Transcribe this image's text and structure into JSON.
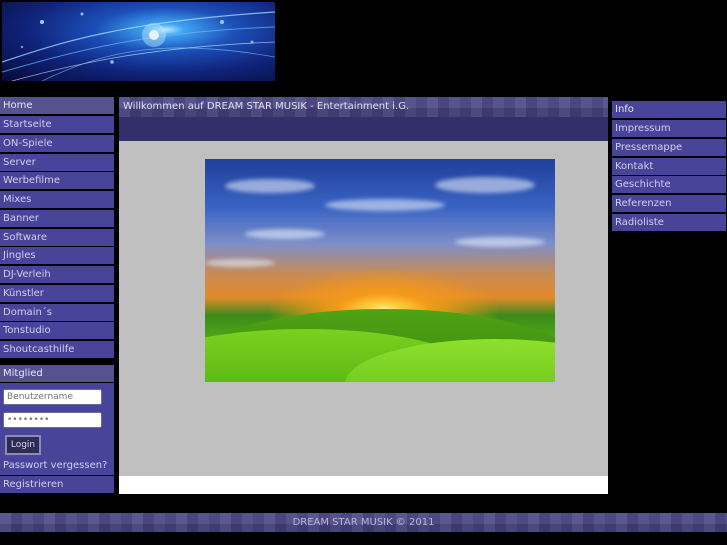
{
  "footer": {
    "copyright": "DREAM STAR MUSIK © 2011"
  },
  "left_nav": {
    "items": [
      "Home",
      "Startseite",
      "ON-Spiele",
      "Server",
      "Werbefilme",
      "Mixes",
      "Banner",
      "Software",
      "Jingles",
      "DJ-Verleih",
      "Künstler",
      "Domain´s",
      "Tonstudio",
      "Shoutcasthilfe"
    ]
  },
  "login": {
    "header": "Mitglied",
    "username_placeholder": "Benutzername",
    "password_value": "••••••••",
    "login_label": "Login",
    "forgot_label": "Passwort vergessen?",
    "register_label": "Registrieren"
  },
  "main": {
    "title": "Willkommen auf DREAM STAR MUSIK - Entertainment i.G."
  },
  "right_nav": {
    "header": "Info",
    "items": [
      "Impressum",
      "Pressemappe",
      "Kontakt",
      "Geschichte",
      "Referenzen",
      "Radioliste"
    ]
  },
  "colors": {
    "nav_bg": "#48449a",
    "strip": "#322f6a",
    "content_gray": "#c0c0c0"
  }
}
